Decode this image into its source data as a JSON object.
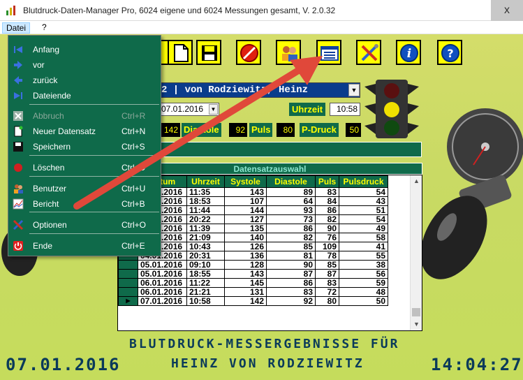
{
  "window": {
    "title": "Blutdruck-Daten-Manager Pro, 6024 eigene und 6024 Messungen gesamt, V. 2.0.32",
    "close_glyph": "x"
  },
  "menubar": {
    "datei": "Datei",
    "help": "?"
  },
  "dropdown": {
    "items": [
      {
        "label": "Anfang",
        "shortcut": "",
        "icon": "first-record-icon"
      },
      {
        "label": "vor",
        "shortcut": "",
        "icon": "forward-icon"
      },
      {
        "label": "zurück",
        "shortcut": "",
        "icon": "back-icon"
      },
      {
        "label": "Dateiende",
        "shortcut": "",
        "icon": "last-record-icon"
      },
      {
        "label": "Abbruch",
        "shortcut": "Ctrl+R",
        "icon": "cancel-icon",
        "disabled": true
      },
      {
        "label": "Neuer Datensatz",
        "shortcut": "Ctrl+N",
        "icon": "new-record-icon"
      },
      {
        "label": "Speichern",
        "shortcut": "Ctrl+S",
        "icon": "save-icon"
      },
      {
        "label": "Löschen",
        "shortcut": "Ctrl+D",
        "icon": "delete-icon"
      },
      {
        "label": "Benutzer",
        "shortcut": "Ctrl+U",
        "icon": "users-icon"
      },
      {
        "label": "Bericht",
        "shortcut": "Ctrl+B",
        "icon": "report-icon"
      },
      {
        "label": "Optionen",
        "shortcut": "Ctrl+O",
        "icon": "options-icon"
      },
      {
        "label": "Ende",
        "shortcut": "Ctrl+E",
        "icon": "exit-icon"
      }
    ]
  },
  "form": {
    "user": "2 | von Rodziewitz, Heinz",
    "date": "07.01.2016",
    "uhrzeit_label": "Uhrzeit",
    "uhrzeit_value": "10:58",
    "systole_value": "142",
    "diastole_label": "Diastole",
    "diastole_value": "92",
    "puls_label": "Puls",
    "puls_value": "80",
    "pdruck_label": "P-Druck",
    "pdruck_value": "50"
  },
  "table": {
    "caption": "Datensatzauswahl",
    "columns": [
      "Datum",
      "Uhrzeit",
      "Systole",
      "Diastole",
      "Puls",
      "Pulsdruck"
    ],
    "rows": [
      [
        "01.01.2016",
        "11:35",
        "143",
        "89",
        "83",
        "54"
      ],
      [
        "01.01.2016",
        "18:53",
        "107",
        "64",
        "84",
        "43"
      ],
      [
        "02.01.2016",
        "11:44",
        "144",
        "93",
        "86",
        "51"
      ],
      [
        "02.01.2016",
        "20:22",
        "127",
        "73",
        "82",
        "54"
      ],
      [
        "03.01.2016",
        "11:39",
        "135",
        "86",
        "90",
        "49"
      ],
      [
        "03.01.2016",
        "21:09",
        "140",
        "82",
        "76",
        "58"
      ],
      [
        "04.01.2016",
        "10:43",
        "126",
        "85",
        "109",
        "41"
      ],
      [
        "04.01.2016",
        "20:31",
        "136",
        "81",
        "78",
        "55"
      ],
      [
        "05.01.2016",
        "09:10",
        "128",
        "90",
        "85",
        "38"
      ],
      [
        "05.01.2016",
        "18:55",
        "143",
        "87",
        "87",
        "56"
      ],
      [
        "06.01.2016",
        "11:22",
        "145",
        "86",
        "83",
        "59"
      ],
      [
        "06.01.2016",
        "21:21",
        "131",
        "83",
        "72",
        "48"
      ],
      [
        "07.01.2016",
        "10:58",
        "142",
        "92",
        "80",
        "50"
      ]
    ]
  },
  "banner": {
    "line1": "BLUTDRUCK-MESSERGEBNISSE FÜR",
    "line2": "HEINZ VON RODZIEWITZ",
    "date": "07.01.2016",
    "time": "14:04:27"
  },
  "colors": {
    "background": "#c9da64",
    "panel": "#0f6a4a",
    "value_text": "#ffff00",
    "arrow": "#e0483a"
  }
}
